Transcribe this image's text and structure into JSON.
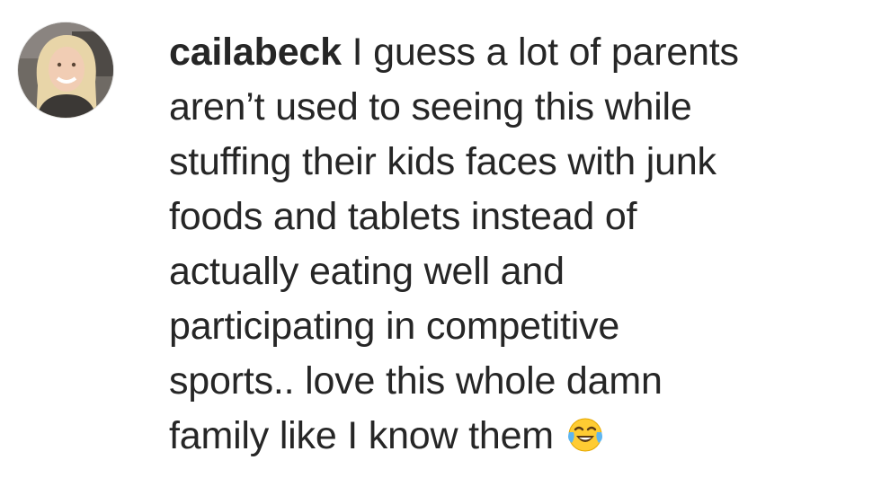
{
  "comment": {
    "username": "cailabeck",
    "lines": [
      " I guess a lot of parents",
      "aren’t used to seeing this while",
      "stuffing their kids faces with junk",
      "foods and tablets instead of",
      "actually eating well and",
      "participating in competitive",
      "sports.. love this whole damn",
      "family like I know them "
    ],
    "emoji": "face-with-tears-of-joy-icon"
  }
}
